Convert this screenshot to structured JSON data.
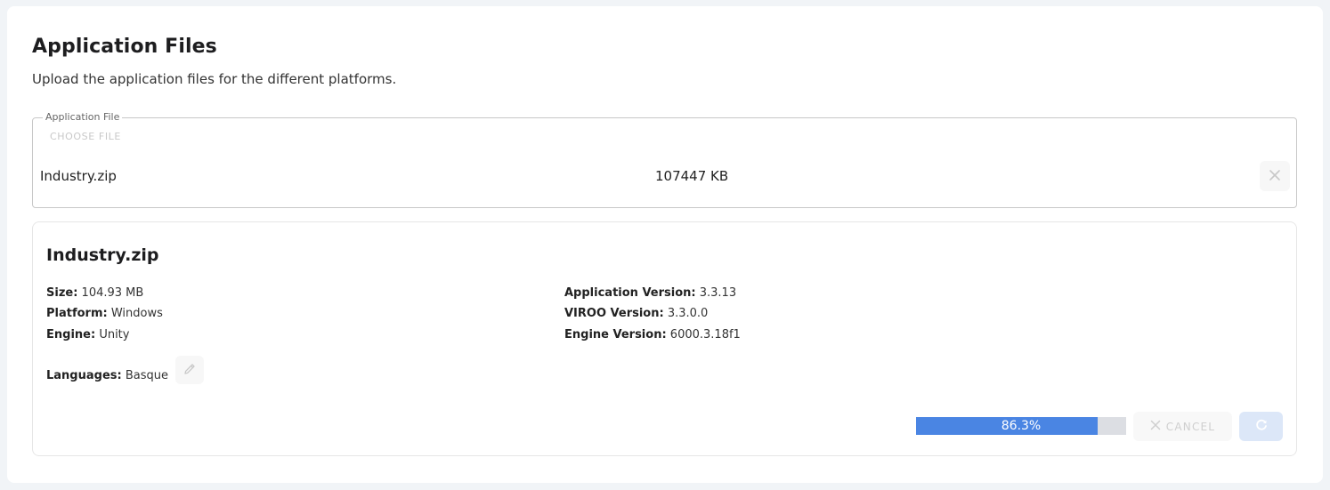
{
  "header": {
    "title": "Application Files",
    "subtitle": "Upload the application files for the different platforms."
  },
  "upload": {
    "legend": "Application File",
    "choose_label": "CHOOSE FILE",
    "file_name": "Industry.zip",
    "file_size": "107447 KB",
    "remove_icon": "close-icon"
  },
  "details": {
    "title": "Industry.zip",
    "size_label": "Size:",
    "size_value": "104.93 MB",
    "platform_label": "Platform:",
    "platform_value": "Windows",
    "engine_label": "Engine:",
    "engine_value": "Unity",
    "app_version_label": "Application Version:",
    "app_version_value": "3.3.13",
    "viroo_version_label": "VIROO Version:",
    "viroo_version_value": "3.3.0.0",
    "engine_version_label": "Engine Version:",
    "engine_version_value": "6000.3.18f1",
    "languages_label": "Languages:",
    "languages_value": "Basque",
    "edit_icon": "pencil-icon"
  },
  "progress": {
    "percent": 86.3,
    "label": "86.3%",
    "fill_color": "#4a85e3",
    "track_color": "#dcdee3"
  },
  "actions": {
    "cancel_label": "CANCEL",
    "cancel_icon": "close-icon",
    "retry_icon": "refresh-icon"
  }
}
